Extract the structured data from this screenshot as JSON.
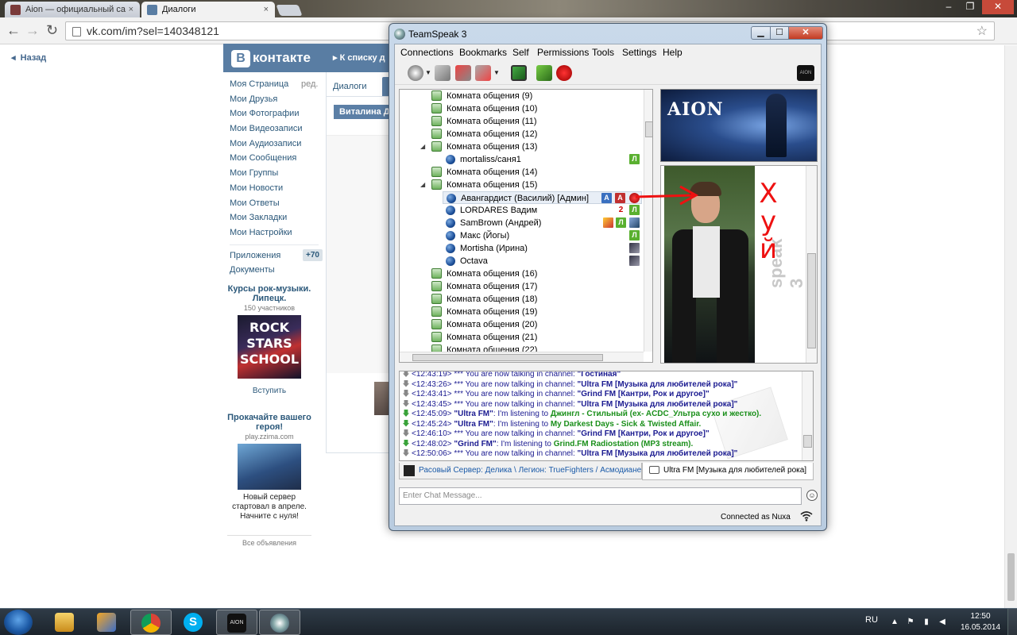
{
  "browser": {
    "tabs": [
      {
        "title": "Aion — официальный са",
        "close": "×"
      },
      {
        "title": "Диалоги",
        "close": "×"
      }
    ],
    "url": "vk.com/im?sel=140348121",
    "window_controls": {
      "minimize": "–",
      "maximize": "❐",
      "close": "✕"
    }
  },
  "vk": {
    "back": "Назад",
    "logo_letter": "В",
    "logo_text": "контакте",
    "header_link": "К списку д",
    "menu": [
      {
        "label": "Моя Страница",
        "aside": "ред."
      },
      {
        "label": "Мои Друзья"
      },
      {
        "label": "Мои Фотографии"
      },
      {
        "label": "Мои Видеозаписи"
      },
      {
        "label": "Мои Аудиозаписи"
      },
      {
        "label": "Мои Сообщения"
      },
      {
        "label": "Мои Группы"
      },
      {
        "label": "Мои Новости"
      },
      {
        "label": "Мои Ответы"
      },
      {
        "label": "Мои Закладки"
      },
      {
        "label": "Мои Настройки"
      }
    ],
    "apps": {
      "label": "Приложения",
      "badge": "+70"
    },
    "docs": "Документы",
    "tabs": {
      "dialogs": "Диалоги"
    },
    "dialog_chip": "Виталина Д",
    "ad1": {
      "title": "Курсы рок-музыки. Липецк.",
      "members": "150 участников",
      "image_text": "ROCK STARS SCHOOL",
      "action": "Вступить"
    },
    "ad2": {
      "title": "Прокачайте вашего героя!",
      "domain": "play.zzima.com",
      "text": "Новый сервер стартовал в апреле. Начните с нуля!"
    },
    "all_ads": "Все объявления"
  },
  "teamspeak": {
    "title": "TeamSpeak 3",
    "menu": [
      "Connections",
      "Bookmarks",
      "Self",
      "Permissions",
      "Tools",
      "Settings",
      "Help"
    ],
    "channels_top": [
      "Комната общения (9)",
      "Комната общения (10)",
      "Комната общения (11)",
      "Комната общения (12)",
      "Комната общения (13)"
    ],
    "channel13_users": [
      {
        "name": "mortaliss/саня1",
        "badge": "Л"
      }
    ],
    "channel14": "Комната общения (14)",
    "channel15": "Комната общения (15)",
    "channel15_users": [
      {
        "name": "Авангардист (Василий) [Админ]",
        "badges": [
          "A",
          "A"
        ]
      },
      {
        "name": "LORDARES Вадим",
        "badges": [
          "2",
          "Л"
        ]
      },
      {
        "name": "SamBrown (Андрей)",
        "badges": [
          "Л"
        ]
      },
      {
        "name": "Макс (Йогы)",
        "badges": [
          "Л"
        ]
      },
      {
        "name": "Mortisha (Ирина)",
        "badges": []
      },
      {
        "name": "Octava",
        "badges": []
      }
    ],
    "channels_bottom": [
      "Комната общения (16)",
      "Комната общения (17)",
      "Комната общения (18)",
      "Комната общения (19)",
      "Комната общения (20)",
      "Комната общения (21)",
      "Комната общения (22)"
    ],
    "banner_text": "AION",
    "red_text": [
      "Х",
      "у",
      "й"
    ],
    "watermark": "speak 3",
    "log": [
      {
        "time": "<12:43:19>",
        "text": "*** You are now talking in channel:",
        "target": "\"Гостиная\"",
        "kind": "sys"
      },
      {
        "time": "<12:43:26>",
        "text": "*** You are now talking in channel:",
        "target": "\"Ultra FM [Музыка для любителей рока]\"",
        "kind": "sys"
      },
      {
        "time": "<12:43:41>",
        "text": "*** You are now talking in channel:",
        "target": "\"Grind FM [Кантри, Рок и другое]\"",
        "kind": "sys"
      },
      {
        "time": "<12:43:45>",
        "text": "*** You are now talking in channel:",
        "target": "\"Ultra FM [Музыка для любителей рока]\"",
        "kind": "sys"
      },
      {
        "time": "<12:45:09>",
        "speaker": "\"Ultra FM\"",
        "text": ": I'm listening to",
        "target": "Джингл - Стильный (ex- ACDC_Ультра сухо и жестко).",
        "kind": "listen"
      },
      {
        "time": "<12:45:24>",
        "speaker": "\"Ultra FM\"",
        "text": ": I'm listening to",
        "target": "My Darkest Days - Sick & Twisted Affair.",
        "kind": "listen"
      },
      {
        "time": "<12:46:10>",
        "text": "*** You are now talking in channel:",
        "target": "\"Grind FM [Кантри, Рок и другое]\"",
        "kind": "sys"
      },
      {
        "time": "<12:48:02>",
        "speaker": "\"Grind FM\"",
        "text": ": I'm listening to",
        "target": "Grind.FM Radiostation (MP3 stream).",
        "kind": "listen"
      },
      {
        "time": "<12:50:06>",
        "text": "*** You are now talking in channel:",
        "target": "\"Ultra FM [Музыка для любителей рока]\"",
        "kind": "sys"
      }
    ],
    "chat_tabs": [
      "Расовый Сервер: Делика \\ Легион: TrueFighters / Асмодиане",
      "Ultra FM [Музыка для любителей рока]"
    ],
    "chat_placeholder": "Enter Chat Message...",
    "status": "Connected as Nuxa"
  },
  "taskbar": {
    "lang": "RU",
    "time": "12:50",
    "date": "16.05.2014"
  },
  "colors": {
    "vk_blue": "#597da3",
    "ts_log_blue": "#1a1a90",
    "ts_log_green": "#1a8f1a",
    "annotation_red": "#e11111"
  }
}
